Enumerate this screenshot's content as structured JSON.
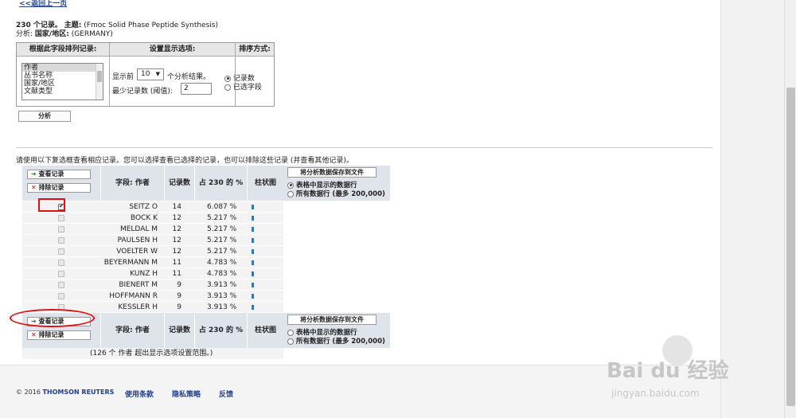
{
  "nav": {
    "back": "<<返回上一页"
  },
  "summary": {
    "count": "230 个记录。",
    "topic_label": "主题:",
    "topic": "(Fmoc Solid Phase Peptide Synthesis)",
    "analysis_label": "分析:",
    "field": "国家/地区:",
    "field_value": "(GERMANY)"
  },
  "options": {
    "col1_header": "根据此字段排列记录:",
    "col2_header": "设置显示选项:",
    "col3_header": "排序方式:",
    "fields": [
      "作者",
      "丛书名称",
      "国家/地区",
      "文献类型"
    ],
    "show_prefix": "显示前",
    "show_value": "10",
    "show_suffix": "个分析结果。",
    "min_label": "最少记录数 (阈值):",
    "min_value": "2",
    "sort_by_count": "记录数",
    "sort_by_field": "已选字段",
    "analyze": "分析"
  },
  "instruction": "请使用以下复选框查看相应记录。您可以选择查看已选择的记录，也可以排除这些记录 (并查看其他记录)。",
  "results": {
    "view_records": "查看记录",
    "exclude_records": "排除记录",
    "col_field": "字段: 作者",
    "col_count": "记录数",
    "col_pct": "占 230 的 %",
    "col_bar": "柱状图",
    "save_button": "将分析数据保存到文件",
    "save_opt1": "表格中显示的数据行",
    "save_opt2": "所有数据行 (最多 200,000)",
    "rows": [
      {
        "name": "SEITZ O",
        "count": "14",
        "pct": "6.087 %"
      },
      {
        "name": "BOCK K",
        "count": "12",
        "pct": "5.217 %"
      },
      {
        "name": "MELDAL M",
        "count": "12",
        "pct": "5.217 %"
      },
      {
        "name": "PAULSEN H",
        "count": "12",
        "pct": "5.217 %"
      },
      {
        "name": "VOELTER W",
        "count": "12",
        "pct": "5.217 %"
      },
      {
        "name": "BEYERMANN M",
        "count": "11",
        "pct": "4.783 %"
      },
      {
        "name": "KUNZ H",
        "count": "11",
        "pct": "4.783 %"
      },
      {
        "name": "BIENERT M",
        "count": "9",
        "pct": "3.913 %"
      },
      {
        "name": "HOFFMANN R",
        "count": "9",
        "pct": "3.913 %"
      },
      {
        "name": "KESSLER H",
        "count": "9",
        "pct": "3.913 %"
      }
    ],
    "note": "(126 个 作者 超出显示选项设置范围。)"
  },
  "footer": {
    "copyright": "© 2016",
    "brand": "THOMSON REUTERS",
    "terms": "使用条款",
    "privacy": "隐私策略",
    "feedback": "反馈"
  },
  "watermark": {
    "brand": "Bai du 经验",
    "url": "jingyan.baidu.com"
  },
  "colors": {
    "accent": "#1f3f8f",
    "highlight": "#e01010",
    "bar": "#3b73b9"
  }
}
